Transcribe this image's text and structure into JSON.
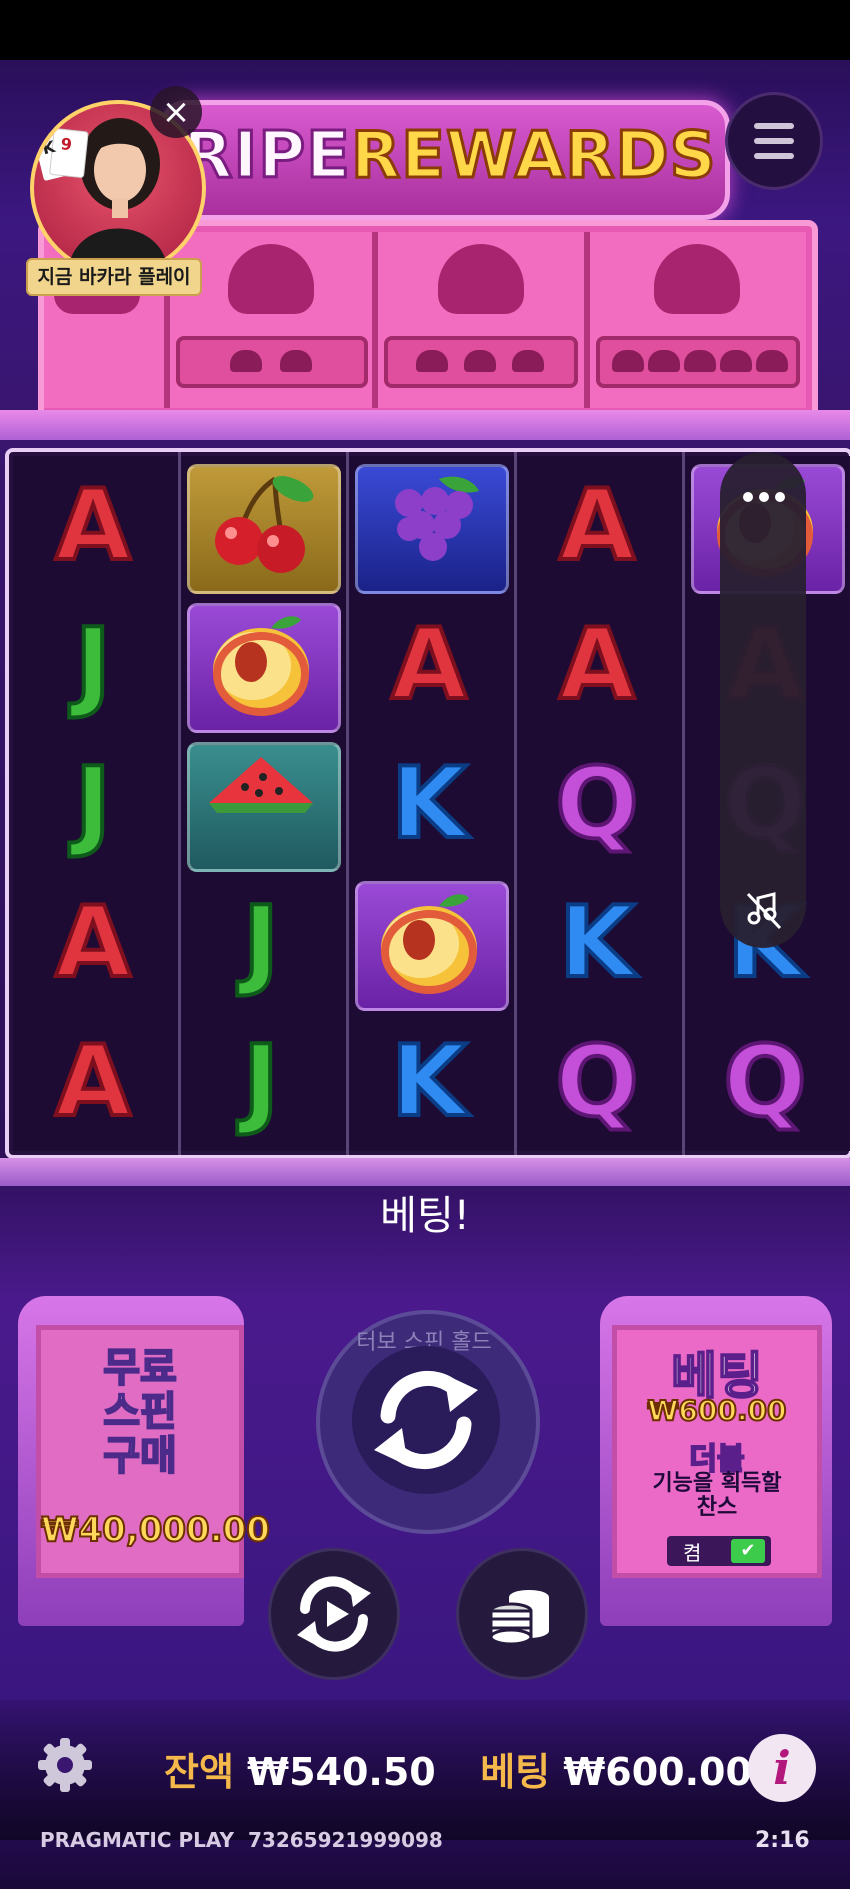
{
  "game": {
    "title_part1": "RIPE",
    "title_part2": "REWARDS",
    "status_message": "베팅!"
  },
  "reels": [
    [
      "A",
      "J",
      "J",
      "A",
      "A"
    ],
    [
      "cherry",
      "peach",
      "watermelon",
      "J",
      "J"
    ],
    [
      "grape",
      "A",
      "K",
      "peach",
      "K"
    ],
    [
      "A",
      "A",
      "Q",
      "K",
      "Q"
    ],
    [
      "peach",
      "A",
      "Q",
      "K",
      "Q"
    ]
  ],
  "buy_feature": {
    "line1": "무료",
    "line2": "스핀",
    "line3": "구매",
    "price": "₩40,000.00"
  },
  "spin": {
    "ring_text": "터보 스핀 홀드"
  },
  "bet_panel": {
    "label": "베팅",
    "amount": "₩600.00",
    "double_label": "더블",
    "double_desc": "기능을 획득할 찬스",
    "toggle_label": "켬"
  },
  "footer": {
    "balance_label": "잔액",
    "balance_value": "₩540.50",
    "bet_label": "베팅",
    "bet_value": "₩600.00",
    "brand": "PRAGMATIC PLAY",
    "round_id": "73265921999098",
    "clock": "2:16"
  },
  "overlay": {
    "close_glyph": "×",
    "promo_label": "지금 바카라 플레이"
  },
  "colors": {
    "accent_gold": "#ffd75a",
    "toggle_on": "#3ccb4a"
  }
}
